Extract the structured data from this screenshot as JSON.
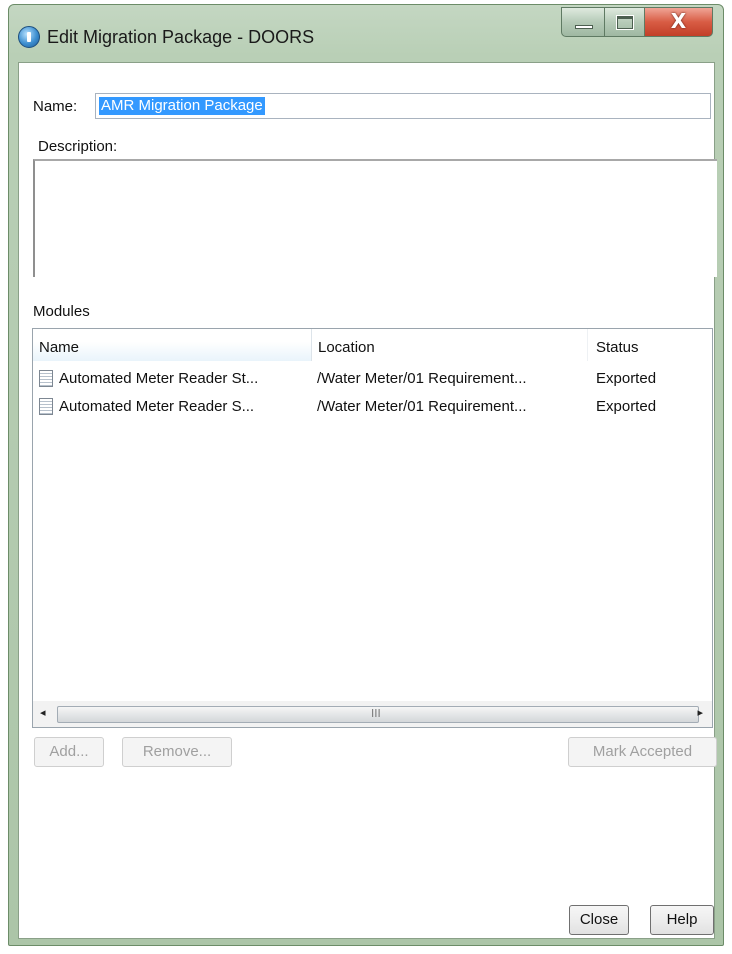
{
  "window": {
    "title": "Edit Migration Package - DOORS",
    "close_glyph": "X"
  },
  "form": {
    "name_label": "Name:",
    "name_value": "AMR Migration Package",
    "description_label": "Description:",
    "description_value": "",
    "modules_label": "Modules"
  },
  "modules": {
    "columns": [
      "Name",
      "Location",
      "Status"
    ],
    "sort_indicator": "^",
    "rows": [
      {
        "name": "Automated Meter Reader St...",
        "location": "/Water Meter/01 Requirement...",
        "status": "Exported"
      },
      {
        "name": "Automated Meter Reader S...",
        "location": "/Water Meter/01 Requirement...",
        "status": "Exported"
      }
    ],
    "scroll_left": "◂",
    "scroll_right": "▸",
    "scroll_grip": "III"
  },
  "buttons": {
    "add": "Add...",
    "remove": "Remove...",
    "mark_accepted": "Mark Accepted",
    "close": "Close",
    "help": "Help"
  },
  "colors": {
    "selection": "#3399ff",
    "frame": "#b9cfb6",
    "close_button": "#d85c44"
  },
  "icons": {
    "app": "doors-app-icon",
    "module": "document-icon"
  }
}
